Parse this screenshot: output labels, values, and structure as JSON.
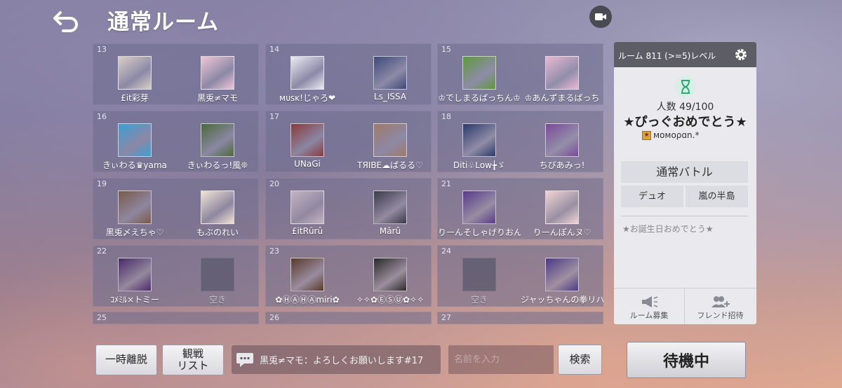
{
  "header": {
    "title": "通常ルーム"
  },
  "teams": [
    {
      "num": "13",
      "slots": [
        {
          "name": "£it彩芽",
          "color": "#d9cfc4",
          "empty": false
        },
        {
          "name": "黒兎≠マモ",
          "color": "#f1c6d6",
          "empty": false
        }
      ]
    },
    {
      "num": "14",
      "slots": [
        {
          "name": "ᴍᴜsᴋ!じゃろ❤",
          "color": "#e9ecf5",
          "empty": false
        },
        {
          "name": "Ls_ISSA",
          "color": "#3d4a7a",
          "empty": false
        }
      ]
    },
    {
      "num": "15",
      "slots": [
        {
          "name": "♔でしまるぱっちん♔",
          "color": "#5f9a3a",
          "empty": false
        },
        {
          "name": "♔あんずまるぱっち",
          "color": "#e9b8d4",
          "empty": false
        }
      ]
    },
    {
      "num": "16",
      "slots": [
        {
          "name": "きぃわる♛yama",
          "color": "#3aa0d6",
          "empty": false
        },
        {
          "name": "きぃわるっ!風❊",
          "color": "#4a6a3a",
          "empty": false
        }
      ]
    },
    {
      "num": "17",
      "slots": [
        {
          "name": "UNaGi",
          "color": "#8a3a3a",
          "empty": false
        },
        {
          "name": "TЯIBE☁ぱるる♡",
          "color": "#a07a6a",
          "empty": false
        }
      ]
    },
    {
      "num": "18",
      "slots": [
        {
          "name": "Diti♧Low╆ゞ",
          "color": "#2a3a6a",
          "empty": false
        },
        {
          "name": "ちびあみっ!",
          "color": "#7a4a9a",
          "empty": false
        }
      ]
    },
    {
      "num": "19",
      "slots": [
        {
          "name": "黒兎〆えちゃ♡",
          "color": "#7a5a4a",
          "empty": false
        },
        {
          "name": "もぶのれい",
          "color": "#f1e4d4",
          "empty": false
        }
      ]
    },
    {
      "num": "20",
      "slots": [
        {
          "name": "£itRūrû",
          "color": "#c4b4c4",
          "empty": false
        },
        {
          "name": "Mārû",
          "color": "#3a3a4a",
          "empty": false
        }
      ]
    },
    {
      "num": "21",
      "slots": [
        {
          "name": "りーんそしゃげりおん",
          "color": "#5a3a8a",
          "empty": false
        },
        {
          "name": "りーんぽんヌ♡",
          "color": "#f1d4d4",
          "empty": false
        }
      ]
    },
    {
      "num": "22",
      "slots": [
        {
          "name": "ｺﾒﾐﾙ×トミー",
          "color": "#4a2a6a",
          "empty": false
        },
        {
          "name": "空き",
          "color": "",
          "empty": true
        }
      ]
    },
    {
      "num": "23",
      "slots": [
        {
          "name": "✿ⒽⒶⒽⒶmiri✿",
          "color": "#5a3a2a",
          "empty": false
        },
        {
          "name": "✧✧✿ⒺⓈⓊ✿✧✧",
          "color": "#2a2a2a",
          "empty": false
        }
      ]
    },
    {
      "num": "24",
      "slots": [
        {
          "name": "空き",
          "color": "",
          "empty": true
        },
        {
          "name": "ジャッちゃんの拳リハ",
          "color": "#4a3a8a",
          "empty": false
        }
      ]
    },
    {
      "num": "25",
      "slots": []
    },
    {
      "num": "26",
      "slots": []
    },
    {
      "num": "27",
      "slots": []
    }
  ],
  "panel": {
    "header": "ルーム 811 (>=5)レベル",
    "count": "人数 49/100",
    "room_name": "★ぴっぐおめでとう★",
    "owner": "ᴍᴏᴍᴏρɑn.*",
    "mode": "通常バトル",
    "options": [
      "デュオ",
      "嵐の半島"
    ],
    "comment": "★お誕生日おめでとう★",
    "recruit_label": "ルーム募集",
    "invite_label": "フレンド招待",
    "accent": "#2aa87a"
  },
  "bottom": {
    "leave_label": "一時離脱",
    "spectate_line1": "観戦",
    "spectate_line2": "リスト",
    "chat_text": "黒兎≠マモ：よろしくお願いします#17",
    "search_placeholder": "名前を入力",
    "search_label": "検索",
    "wait_label": "待機中"
  }
}
